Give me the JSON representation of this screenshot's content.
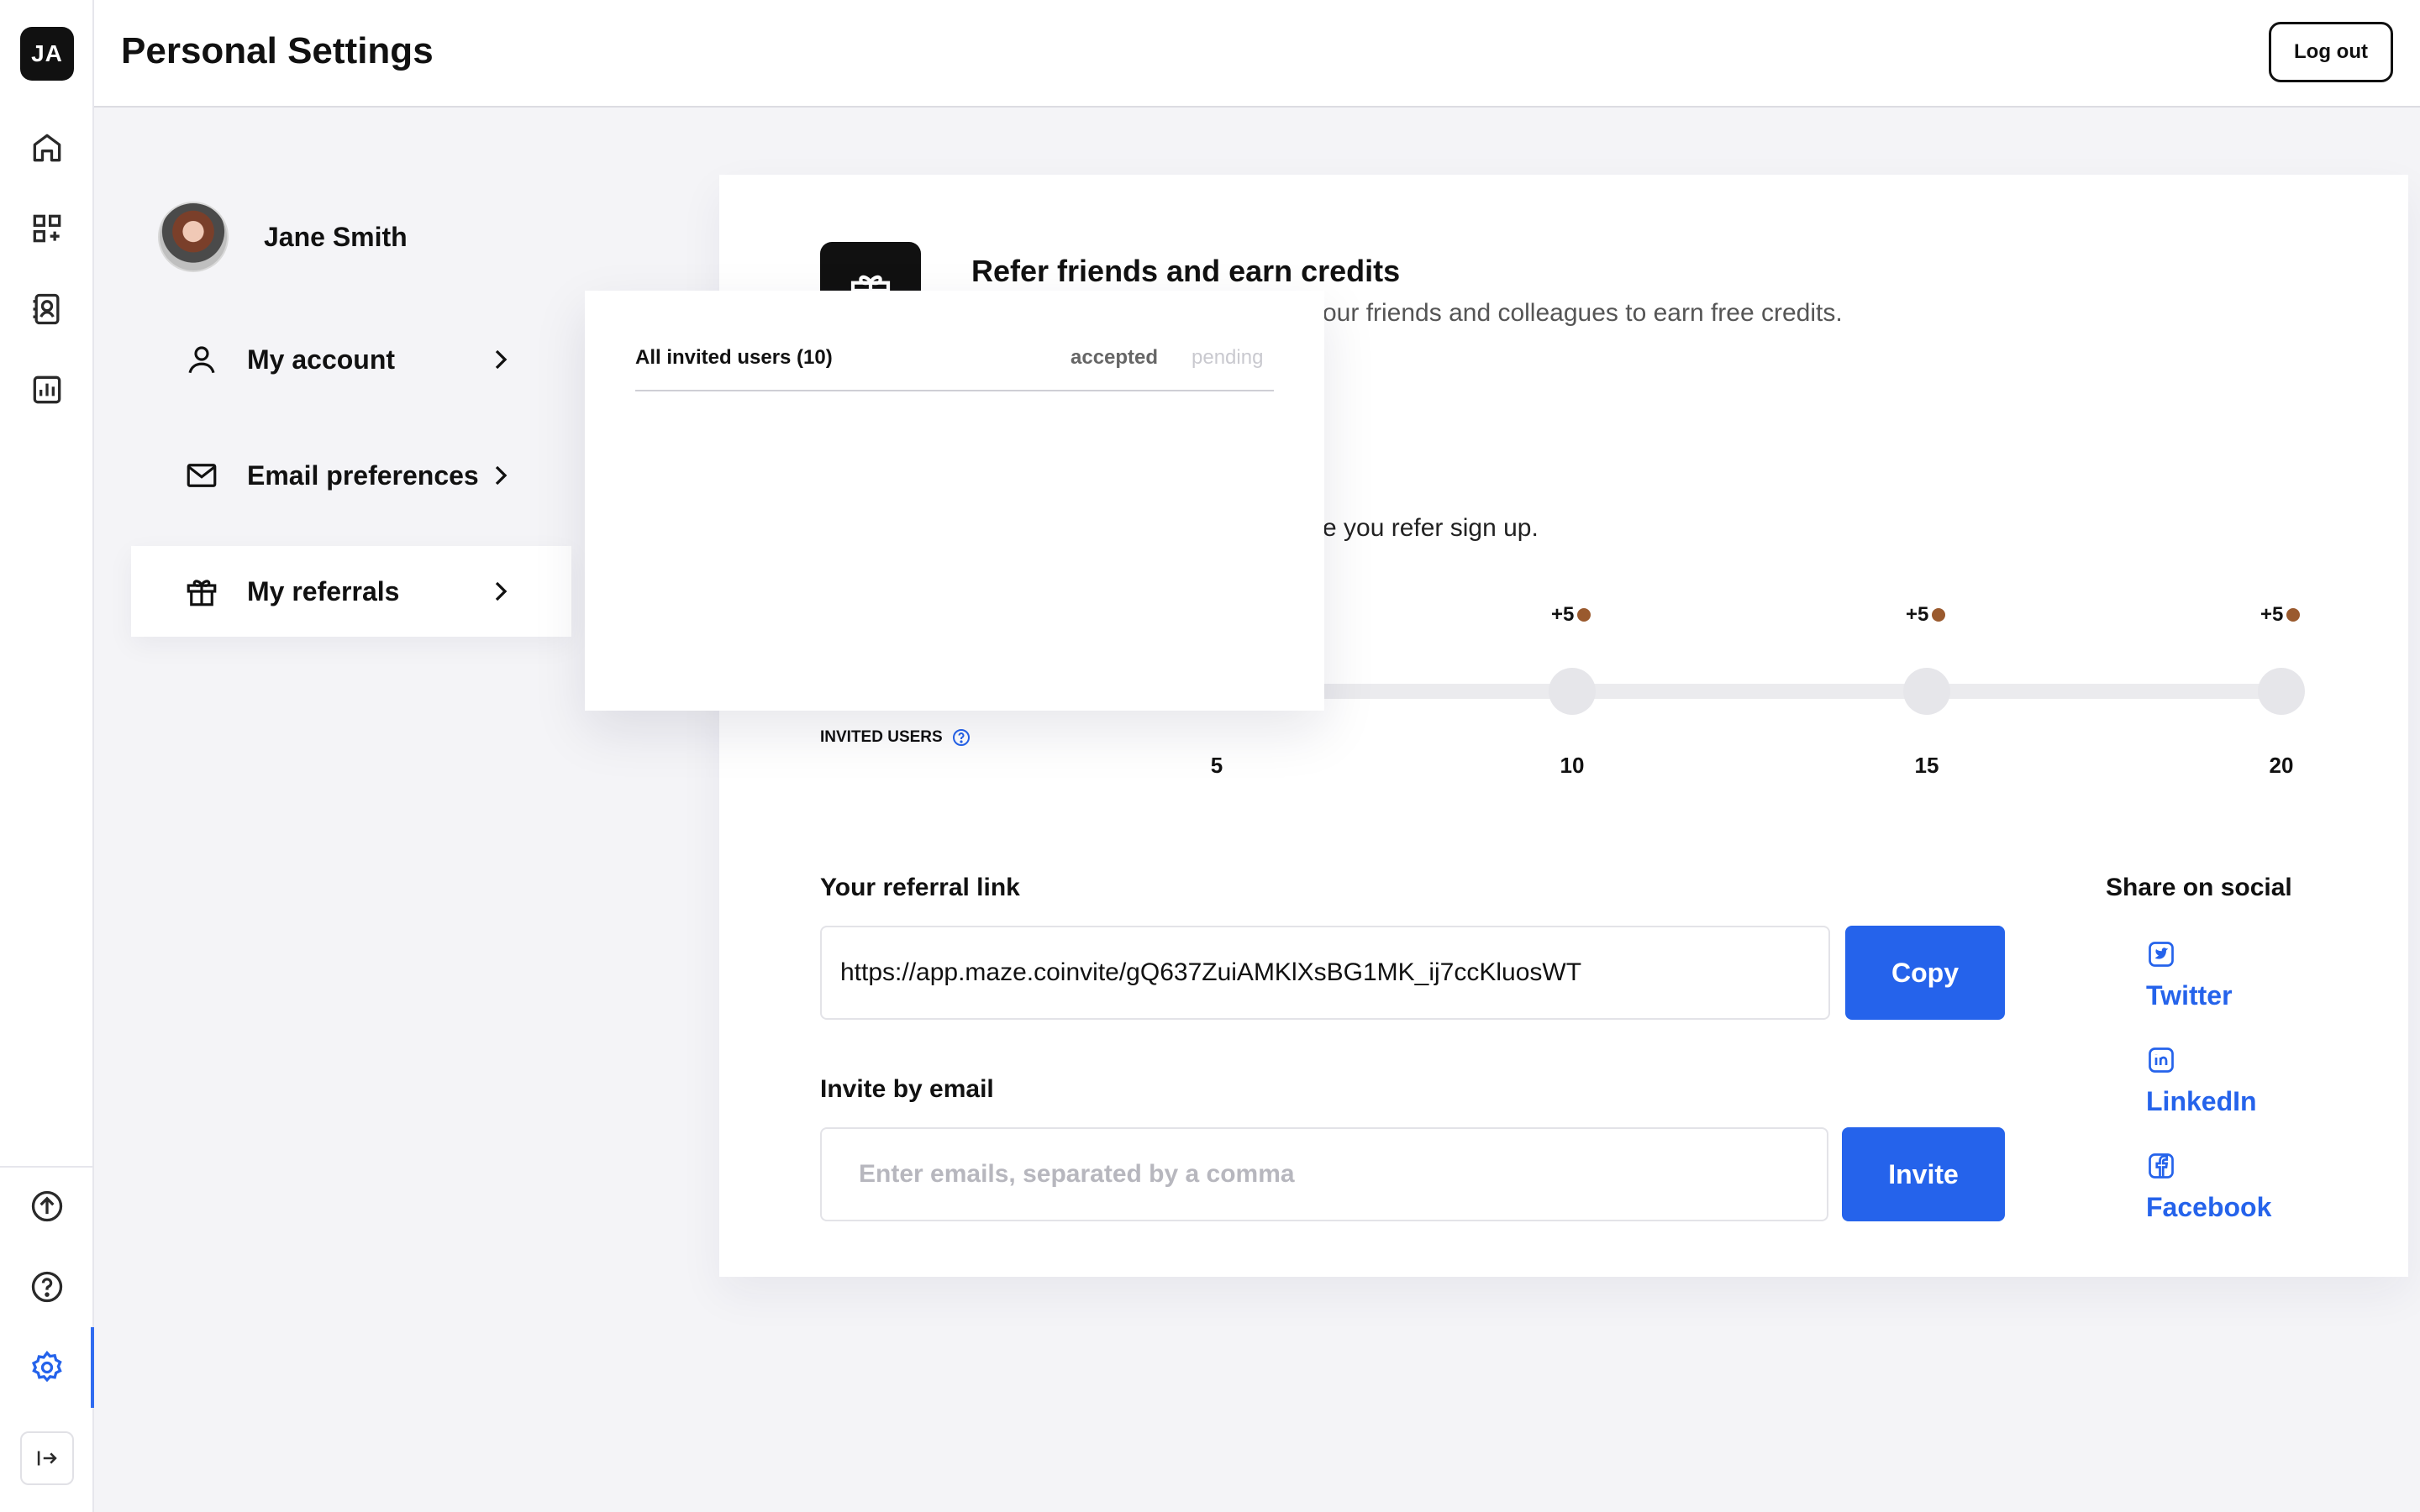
{
  "rail": {
    "logo_text": "JA",
    "icons": [
      "home-icon",
      "apps-icon",
      "contacts-icon",
      "analytics-icon",
      "upgrade-icon",
      "help-icon",
      "settings-icon",
      "collapse-icon"
    ]
  },
  "header": {
    "title": "Personal Settings",
    "logout_label": "Log out"
  },
  "profile": {
    "name": "Jane Smith"
  },
  "nav": {
    "items": [
      {
        "label": "My account",
        "icon": "user-icon"
      },
      {
        "label": "Email preferences",
        "icon": "mail-icon"
      },
      {
        "label": "My referrals",
        "icon": "gift-icon",
        "active": true
      }
    ]
  },
  "referral": {
    "title": "Refer friends and earn credits",
    "subtitle_visible": "our friends and colleagues to earn free credits.",
    "subtitle2_visible": "e you refer sign up.",
    "invited_label": "INVITED USERS",
    "milestones": [
      {
        "value": "5",
        "reward": ""
      },
      {
        "value": "10",
        "reward": "+5"
      },
      {
        "value": "15",
        "reward": "+5"
      },
      {
        "value": "20",
        "reward": "+5"
      }
    ],
    "link_label": "Your referral link",
    "link_value": "https://app.maze.coinvite/gQ637ZuiAMKlXsBG1MK_ij7ccKluosWT",
    "copy_label": "Copy",
    "invite_label": "Invite by email",
    "invite_placeholder": "Enter emails, separated by a comma",
    "invite_button": "Invite",
    "share_title": "Share on social",
    "social": [
      {
        "label": "Twitter",
        "icon": "twitter-icon"
      },
      {
        "label": "LinkedIn",
        "icon": "linkedin-icon"
      },
      {
        "label": "Facebook",
        "icon": "facebook-icon"
      }
    ]
  },
  "popover": {
    "title": "All invited users (10)",
    "tab_accepted": "accepted",
    "tab_pending": "pending"
  },
  "colors": {
    "accent": "#2563eb",
    "reward_dot": "#9a5a2e",
    "dark": "#111111"
  }
}
